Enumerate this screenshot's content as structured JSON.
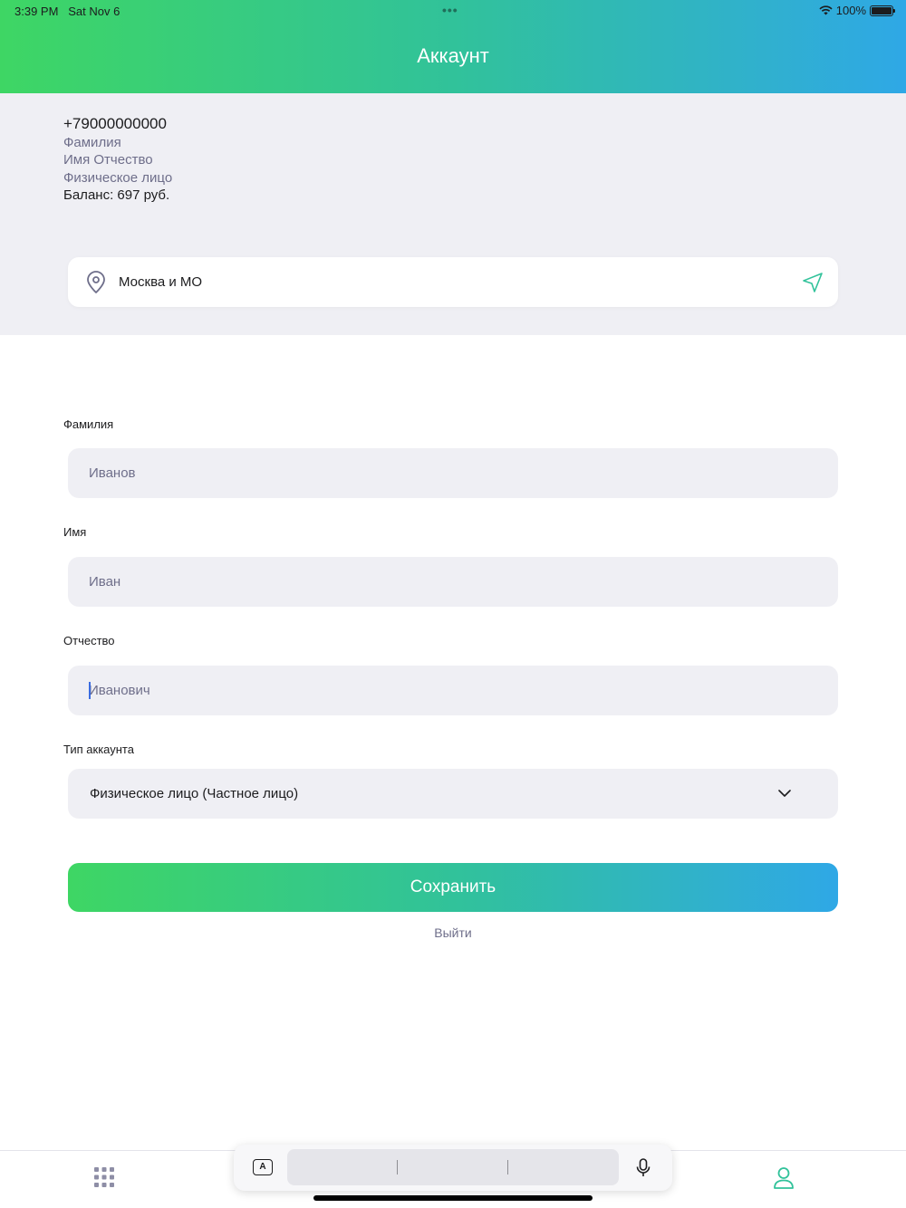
{
  "status_bar": {
    "time": "3:39 PM",
    "date": "Sat Nov 6",
    "battery": "100%"
  },
  "header": {
    "title": "Аккаунт"
  },
  "profile": {
    "phone": "+79000000000",
    "surname": "Фамилия",
    "name_patronymic": "Имя Отчество",
    "account_type": "Физическое лицо",
    "balance": "Баланс: 697 руб."
  },
  "region": {
    "value": "Москва и МО"
  },
  "form": {
    "surname": {
      "label": "Фамилия",
      "placeholder": "Иванов"
    },
    "name": {
      "label": "Имя",
      "placeholder": "Иван"
    },
    "patronymic": {
      "label": "Отчество",
      "placeholder": "Иванович"
    },
    "account_type": {
      "label": "Тип аккаунта",
      "value": "Физическое лицо (Частное лицо)"
    }
  },
  "actions": {
    "save": "Сохранить",
    "logout": "Выйти"
  },
  "colors": {
    "gradient_start": "#3ed664",
    "gradient_end": "#2fa8e6",
    "field_bg": "#efeff4",
    "accent": "#31c29a"
  },
  "tabbar": {
    "items": [
      "grid-icon",
      "user-icon"
    ]
  }
}
